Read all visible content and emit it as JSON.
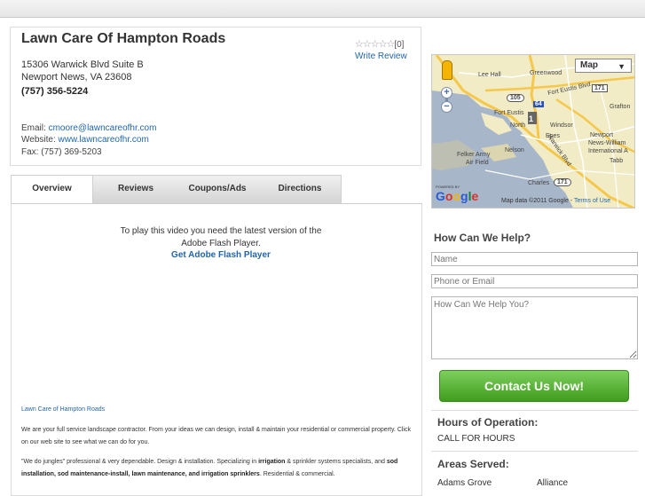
{
  "business": {
    "name": "Lawn Care Of Hampton Roads",
    "address_line1": "15306 Warwick Blvd Suite B",
    "address_line2": "Newport News, VA 23608",
    "phone": "(757) 356-5224",
    "email_label": "Email:",
    "email": "cmoore@lawncareofhr.com",
    "website_label": "Website:",
    "website": "www.lawncareofhr.com",
    "fax_label": "Fax:",
    "fax": "(757) 369-5203",
    "stars": "☆☆☆☆☆",
    "review_count": "[0]",
    "write_review": "Write Review"
  },
  "tabs": [
    {
      "label": "Overview"
    },
    {
      "label": "Reviews"
    },
    {
      "label": "Coupons/Ads"
    },
    {
      "label": "Directions"
    }
  ],
  "overview": {
    "flash_line1": "To play this video you need the latest version of the",
    "flash_line2": "Adobe Flash Player.",
    "flash_link": "Get Adobe Flash Player",
    "desc_title": "Lawn Care of Hampton Roads",
    "desc_p1": "We are your full service landscape contractor. From your ideas we can design, install & maintain your residential or commercial property. Click on our web site to see what we can do for you.",
    "desc_p2_a": "\"We do jungles\" professional & very dependable. Design & installation. Specializing in ",
    "desc_p2_b": "irrigation",
    "desc_p2_c": " & sprinkler systems specialists, and ",
    "desc_p2_d": "sod installation, sod maintenance-install, lawn maintenance, and ",
    "desc_p2_e": "irrigation",
    "desc_p2_f": " sprinklers",
    "desc_p2_g": ". Residential & commercial."
  },
  "map": {
    "type_label": "Map",
    "zoom_in": "+",
    "zoom_out": "−",
    "powered_by": "POWERED BY",
    "google": [
      "G",
      "o",
      "o",
      "g",
      "l",
      "e"
    ],
    "attribution": "Map data ©2011 Google - ",
    "terms": "Terms of Use",
    "labels": {
      "lee_hall": "Lee Hall",
      "greenwood": "Greenwood",
      "fort_eustis_blvd": "Fort Eustis Blvd",
      "fort_eustis": "Fort Eustis",
      "north": "North",
      "grafton": "Grafton",
      "windsor": "Windsor",
      "epes": "Epes",
      "newport": "Newport",
      "news_william": "News-William",
      "international": "International A",
      "felker_army": "Felker Army",
      "air_field": "Air Field",
      "nelson": "Nelson",
      "warwick_blvd": "Warwick Blvd",
      "tabb": "Tabb",
      "charles": "Charles"
    },
    "shields": {
      "r105": "105",
      "r64": "64",
      "r171a": "171",
      "r171b": "171",
      "r1": "1"
    },
    "colors": {
      "land": "#f2ecc6",
      "water": "#a8b6c9",
      "highway": "#f5c74a",
      "road": "#ffffff"
    }
  },
  "help": {
    "title": "How Can We Help?",
    "name_placeholder": "Name",
    "contact_placeholder": "Phone or Email",
    "message_placeholder": "How Can We Help You?",
    "button": "Contact Us Now!",
    "button_color": "#4caf2a"
  },
  "hours": {
    "title": "Hours of Operation:",
    "value": "CALL FOR HOURS"
  },
  "areas": {
    "title": "Areas Served:",
    "items": [
      "Adams Grove",
      "Alliance"
    ]
  }
}
